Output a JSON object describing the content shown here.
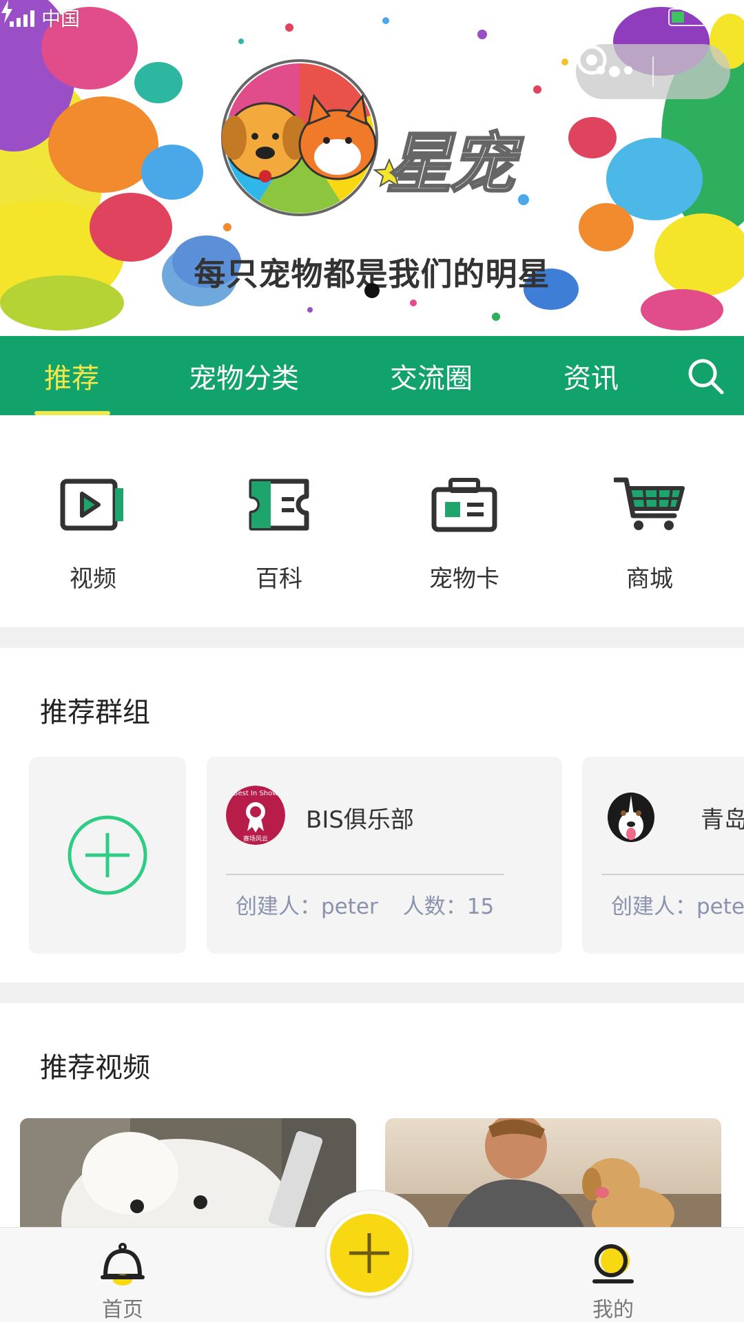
{
  "status_bar": {
    "carrier": "中国"
  },
  "banner": {
    "brand": "星宠",
    "slogan": "每只宠物都是我们的明星"
  },
  "nav": {
    "tabs": [
      {
        "label": "推荐",
        "active": true
      },
      {
        "label": "宠物分类",
        "active": false
      },
      {
        "label": "交流圈",
        "active": false
      },
      {
        "label": "资讯",
        "active": false
      }
    ]
  },
  "quick_entries": [
    {
      "label": "视频",
      "icon": "video-icon"
    },
    {
      "label": "百科",
      "icon": "encyclopedia-icon"
    },
    {
      "label": "宠物卡",
      "icon": "pet-card-icon"
    },
    {
      "label": "商城",
      "icon": "cart-icon"
    }
  ],
  "groups": {
    "title": "推荐群组",
    "items": [
      {
        "name": "BIS俱乐部",
        "creator_label": "创建人：",
        "creator": "peter",
        "count_label": "人数：",
        "count": "15",
        "avatar_text_top": "Best In Show",
        "avatar_text_bottom": "赛场风云"
      },
      {
        "name": "青岛边",
        "creator_label": "创建人：",
        "creator": "pete"
      }
    ]
  },
  "videos": {
    "title": "推荐视频"
  },
  "tabbar": {
    "home": "首页",
    "mine": "我的"
  },
  "colors": {
    "nav_green": "#12a26c",
    "active_yellow": "#f2e84a",
    "fab_yellow": "#f7d812",
    "accent_green": "#2ecc85"
  }
}
